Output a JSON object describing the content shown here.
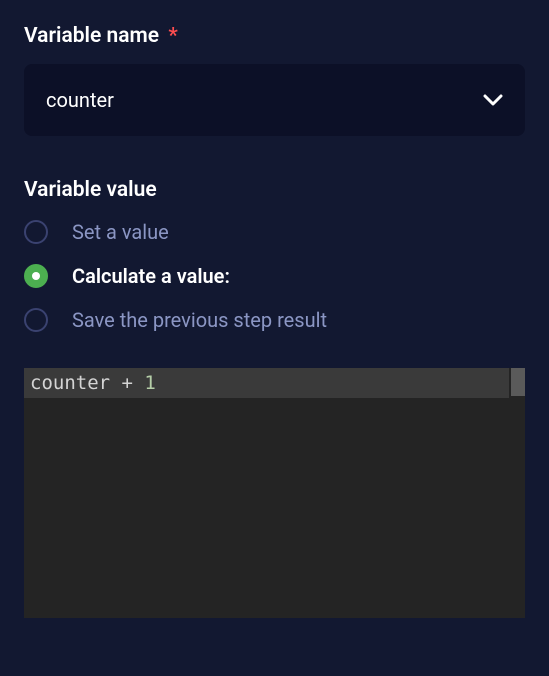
{
  "variableName": {
    "label": "Variable name",
    "required": "*",
    "selected": "counter"
  },
  "variableValue": {
    "label": "Variable value",
    "options": [
      {
        "label": "Set a value",
        "selected": false
      },
      {
        "label": "Calculate a value:",
        "selected": true
      },
      {
        "label": "Save the previous step result",
        "selected": false
      }
    ]
  },
  "codeEditor": {
    "tokens": {
      "var": "counter",
      "op": " + ",
      "num": "1"
    }
  }
}
